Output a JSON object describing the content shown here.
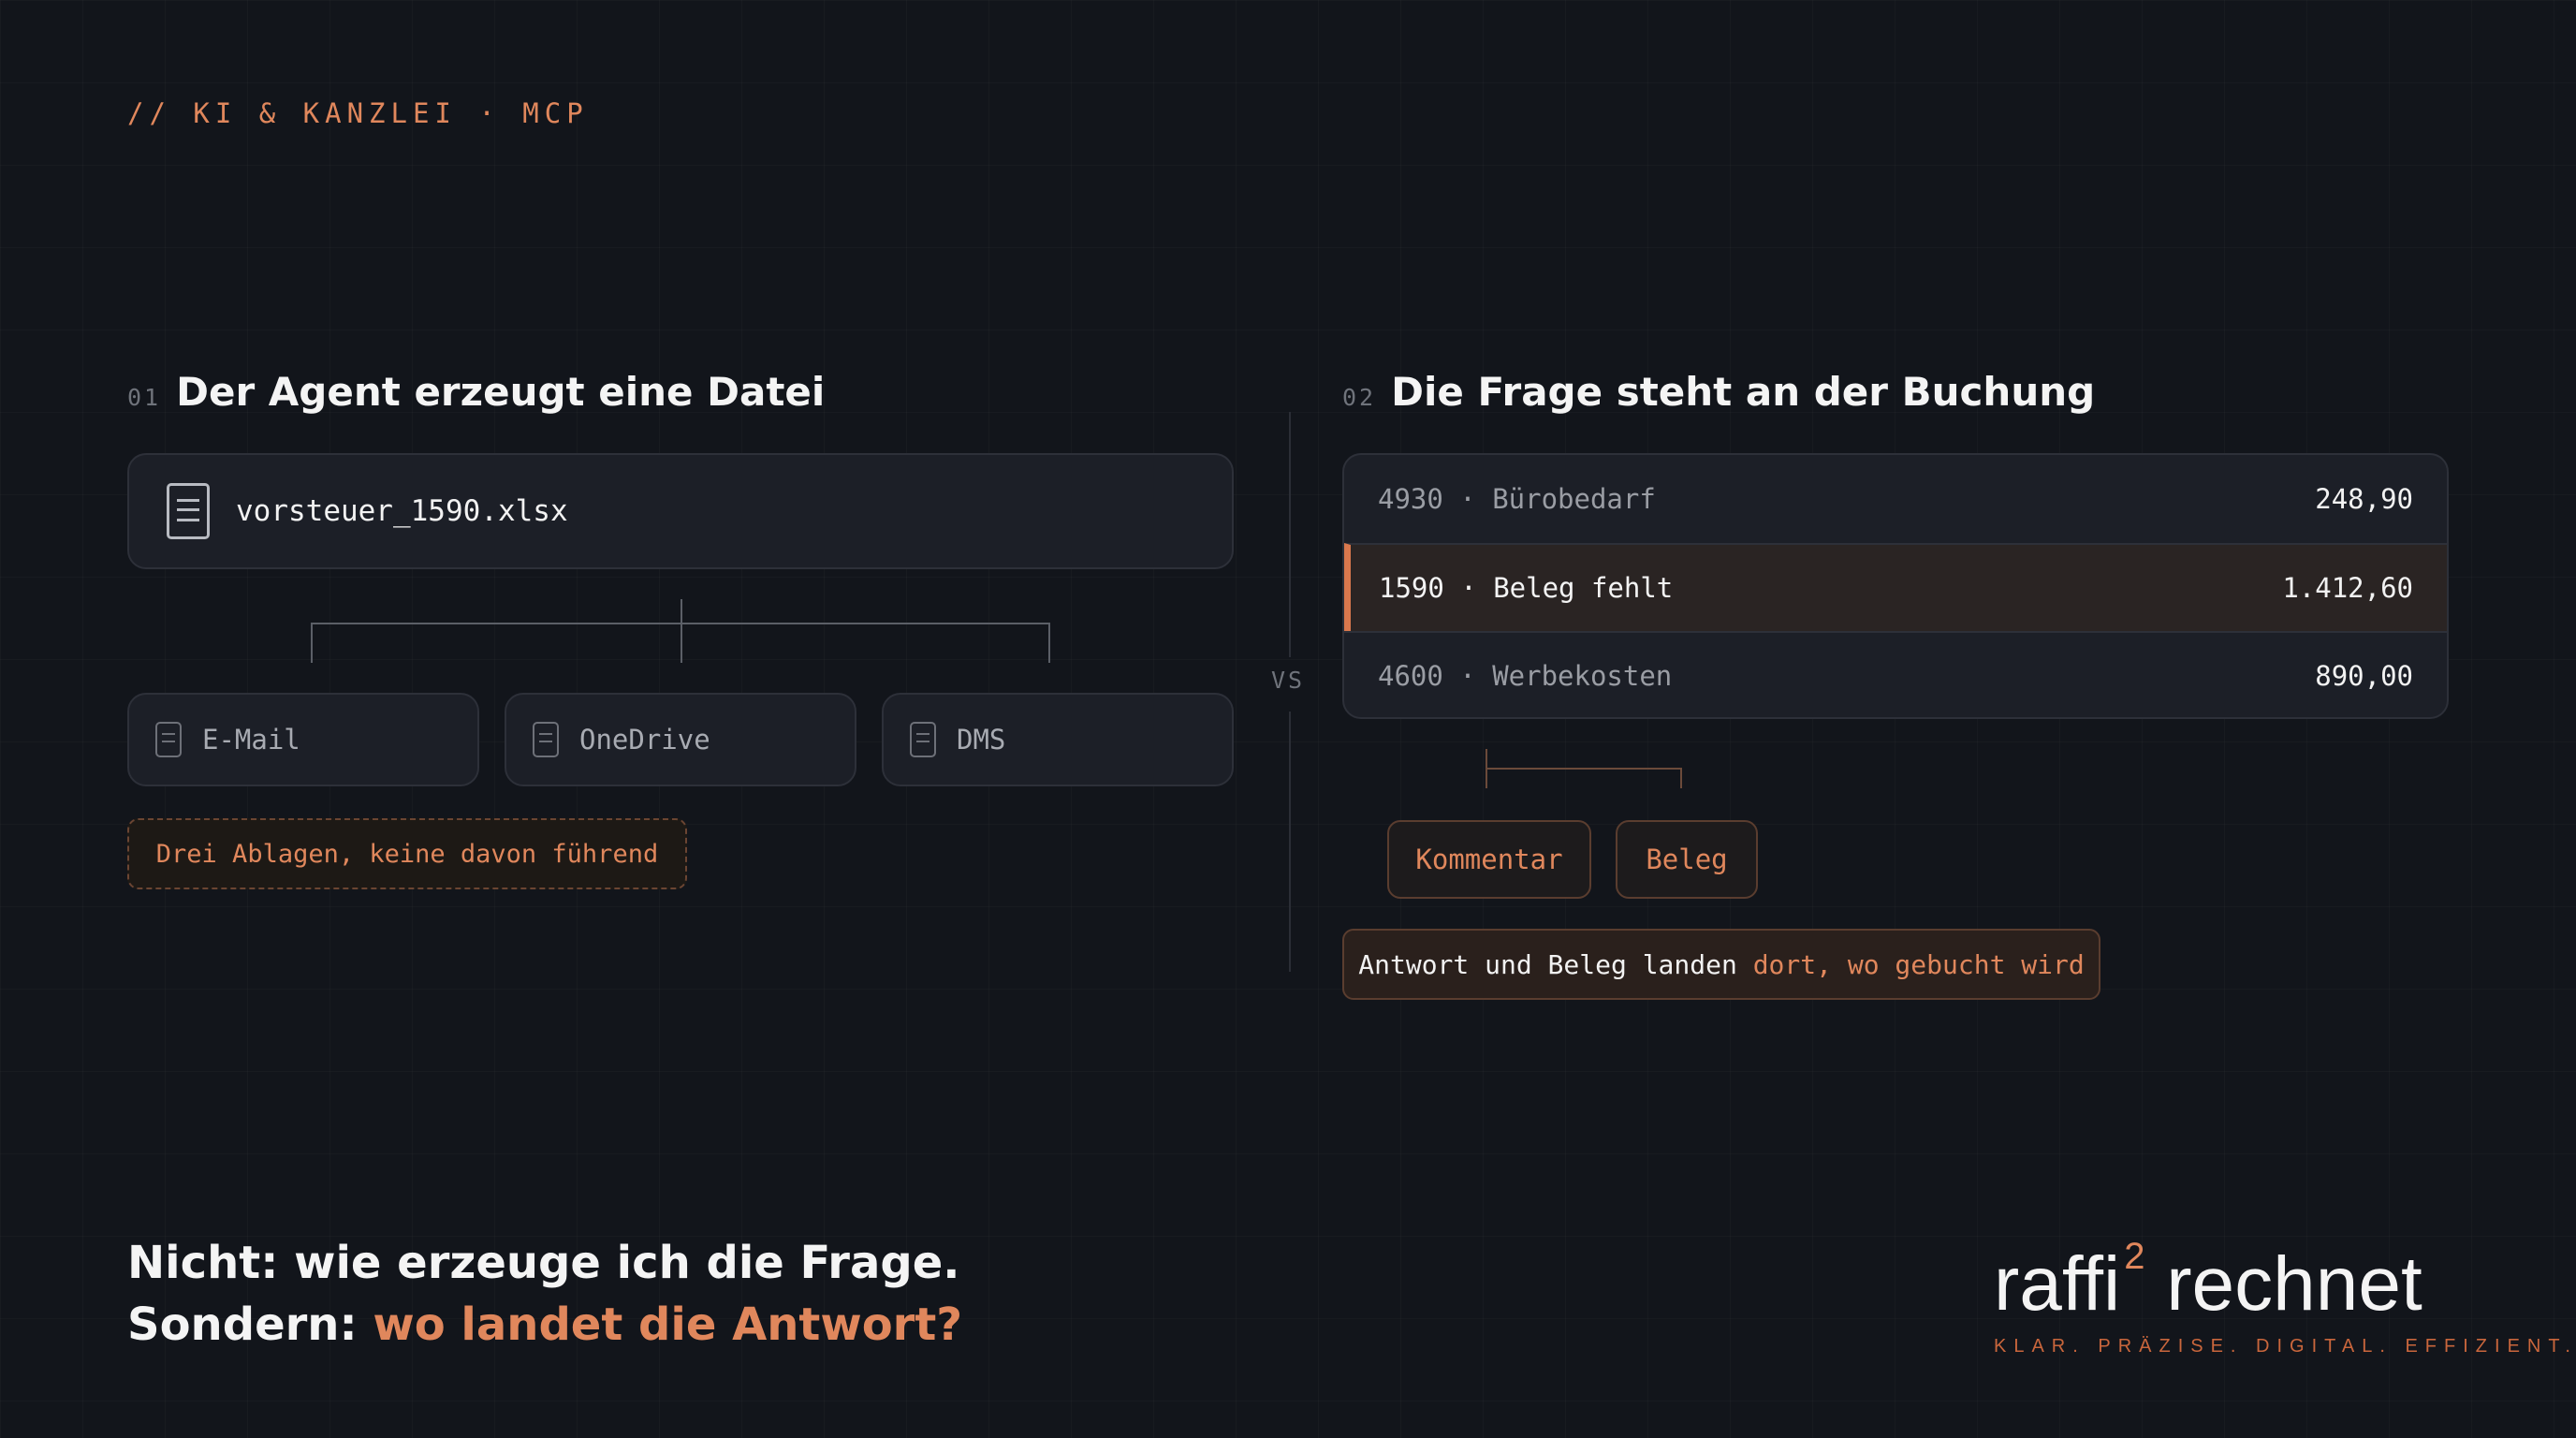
{
  "kicker": "// KI & KANZLEI · MCP",
  "left": {
    "number": "01",
    "title": "Der Agent erzeugt eine Datei",
    "file_name": "vorsteuer_1590.xlsx",
    "stores": [
      "E-Mail",
      "OneDrive",
      "DMS"
    ],
    "warning": "Drei Ablagen, keine davon führend"
  },
  "vs": "VS",
  "right": {
    "number": "02",
    "title": "Die Frage steht an der Buchung",
    "rows": [
      {
        "account": "4930 · Bürobedarf",
        "amount": "248,90"
      },
      {
        "account": "1590 · Beleg fehlt",
        "amount": "1.412,60"
      },
      {
        "account": "4600 · Werbekosten",
        "amount": "890,00"
      }
    ],
    "actions": [
      "Kommentar",
      "Beleg"
    ],
    "answer_part1": "Antwort und Beleg landen ",
    "answer_part2": "dort, wo gebucht wird"
  },
  "bottom": {
    "line1": "Nicht: wie erzeuge ich die Frage.",
    "line2_prefix": "Sondern: ",
    "line2_accent": "wo landet die Antwort?"
  },
  "logo": {
    "word1": "raffi",
    "sup": "2",
    "word2": " rechnet",
    "tagline": "KLAR. PRÄZISE. DIGITAL. EFFIZIENT."
  },
  "colors": {
    "background": "#12151b",
    "accent": "#e0875c",
    "card": "#1c1f27",
    "text": "#f4f4f4"
  }
}
